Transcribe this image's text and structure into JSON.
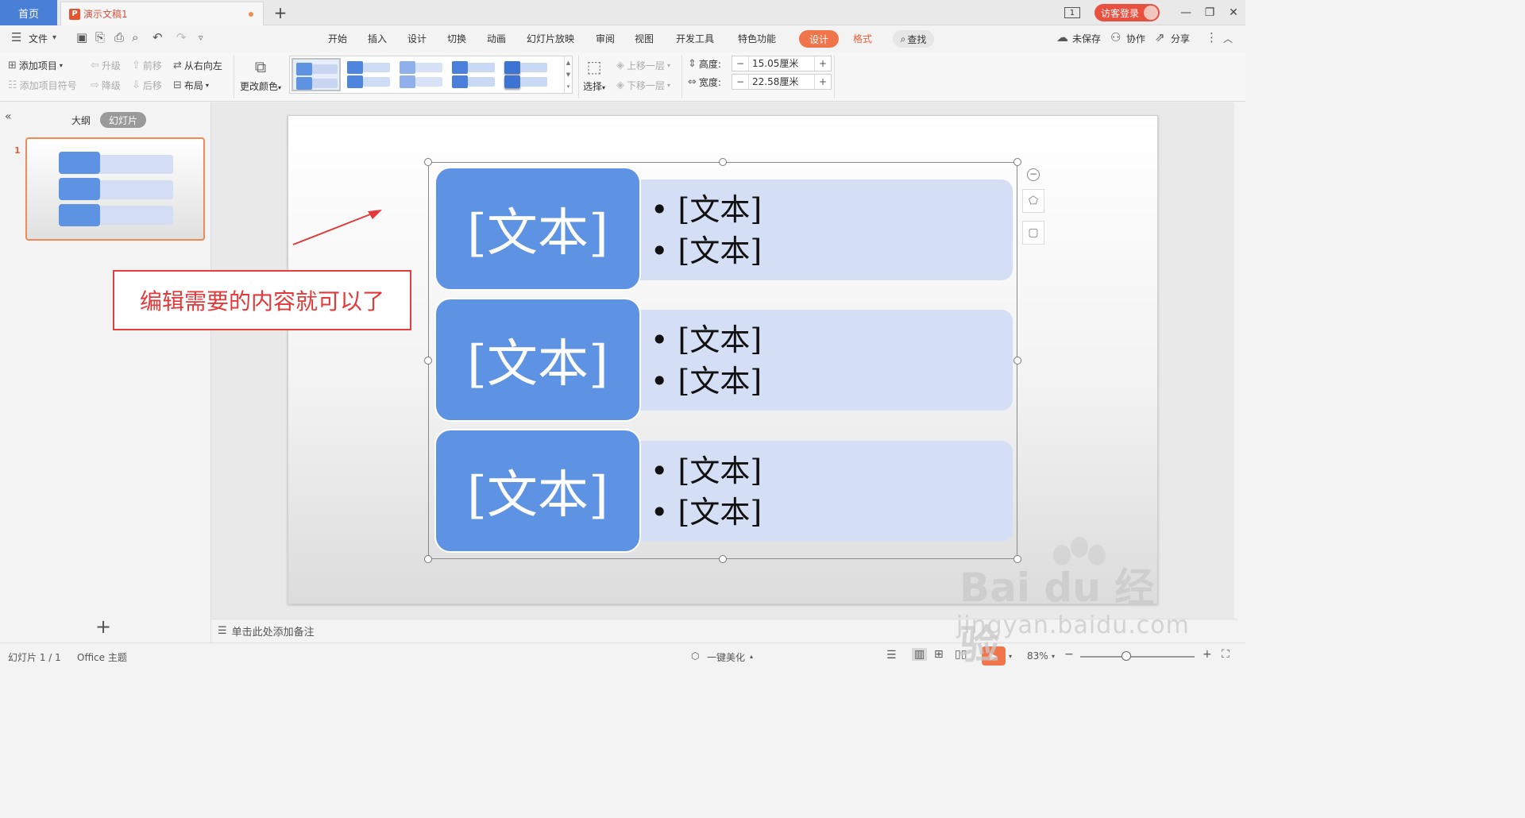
{
  "titlebar": {
    "home_tab": "首页",
    "doc_tab": "演示文稿1",
    "doc_logo": "P",
    "new_tab": "+",
    "window_badge": "1",
    "login": "访客登录",
    "minimize": "—",
    "restore": "❐",
    "close": "✕"
  },
  "menubar": {
    "file": "文件",
    "tabs": [
      "开始",
      "插入",
      "设计",
      "切换",
      "动画",
      "幻灯片放映",
      "审阅",
      "视图",
      "开发工具",
      "特色功能"
    ],
    "design_active": "设计",
    "format": "格式",
    "search": "查找",
    "unsaved": "未保存",
    "collab": "协作",
    "share": "分享"
  },
  "ribbon": {
    "add_item": "添加项目",
    "add_bullet": "添加项目符号",
    "promote": "升级",
    "demote": "降级",
    "move_forward": "前移",
    "move_back": "后移",
    "right_to_left": "从右向左",
    "layout": "布局",
    "change_color": "更改颜色",
    "select": "选择",
    "bring_forward": "上移一层",
    "send_backward": "下移一层",
    "height_label": "高度:",
    "height_value": "15.05厘米",
    "width_label": "宽度:",
    "width_value": "22.58厘米"
  },
  "left_pane": {
    "outline_tab": "大纲",
    "slides_tab": "幻灯片",
    "slide_number": "1"
  },
  "slide": {
    "rows": [
      {
        "title": "[文本]",
        "bullets": [
          "[文本]",
          "[文本]"
        ]
      },
      {
        "title": "[文本]",
        "bullets": [
          "[文本]",
          "[文本]"
        ]
      },
      {
        "title": "[文本]",
        "bullets": [
          "[文本]",
          "[文本]"
        ]
      }
    ],
    "annotation": "编辑需要的内容就可以了"
  },
  "notes": {
    "placeholder": "单击此处添加备注"
  },
  "statusbar": {
    "slide_count": "幻灯片 1 / 1",
    "theme": "Office 主题",
    "beautify": "一键美化",
    "zoom": "83%"
  },
  "watermark": {
    "brand": "Bai du 经验",
    "url": "jingyan.baidu.com"
  },
  "colors": {
    "accent_orange": "#f0754a",
    "home_blue": "#4a7fd8",
    "smartart_blue": "#5e92e2",
    "smartart_light": "#d4dff5",
    "annotation_red": "#e24040"
  }
}
